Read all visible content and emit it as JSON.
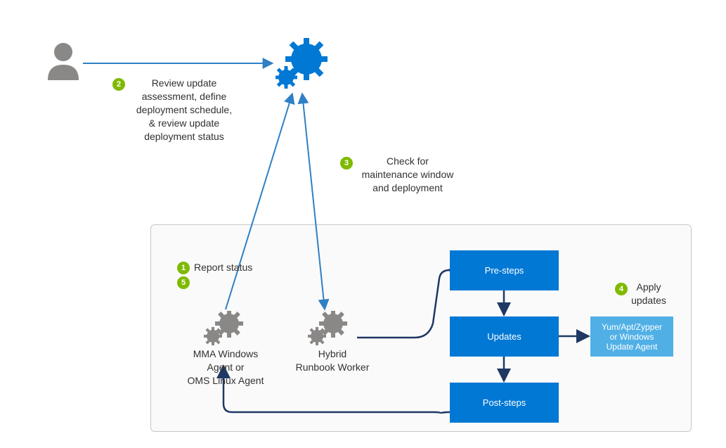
{
  "nodes": {
    "user": {
      "label": ""
    },
    "automation": {
      "label": ""
    },
    "agent": {
      "label": "MMA Windows\nAgent or\nOMS Linux Agent"
    },
    "hrw": {
      "label": "Hybrid\nRunbook Worker"
    },
    "pre": {
      "label": "Pre-steps"
    },
    "updates": {
      "label": "Updates"
    },
    "post": {
      "label": "Post-steps"
    },
    "updater": {
      "label": "Yum/Apt/Zypper\nor Windows\nUpdate Agent"
    }
  },
  "steps": {
    "s1": {
      "num": "1",
      "label": "Report status"
    },
    "s2": {
      "num": "2",
      "label": "Review update\nassessment, define\ndeployment schedule,\n& review update\ndeployment status"
    },
    "s3": {
      "num": "3",
      "label": "Check for\nmaintenance window\nand deployment"
    },
    "s4": {
      "num": "4",
      "label": "Apply\nupdates"
    },
    "s5": {
      "num": "5",
      "label": ""
    }
  }
}
